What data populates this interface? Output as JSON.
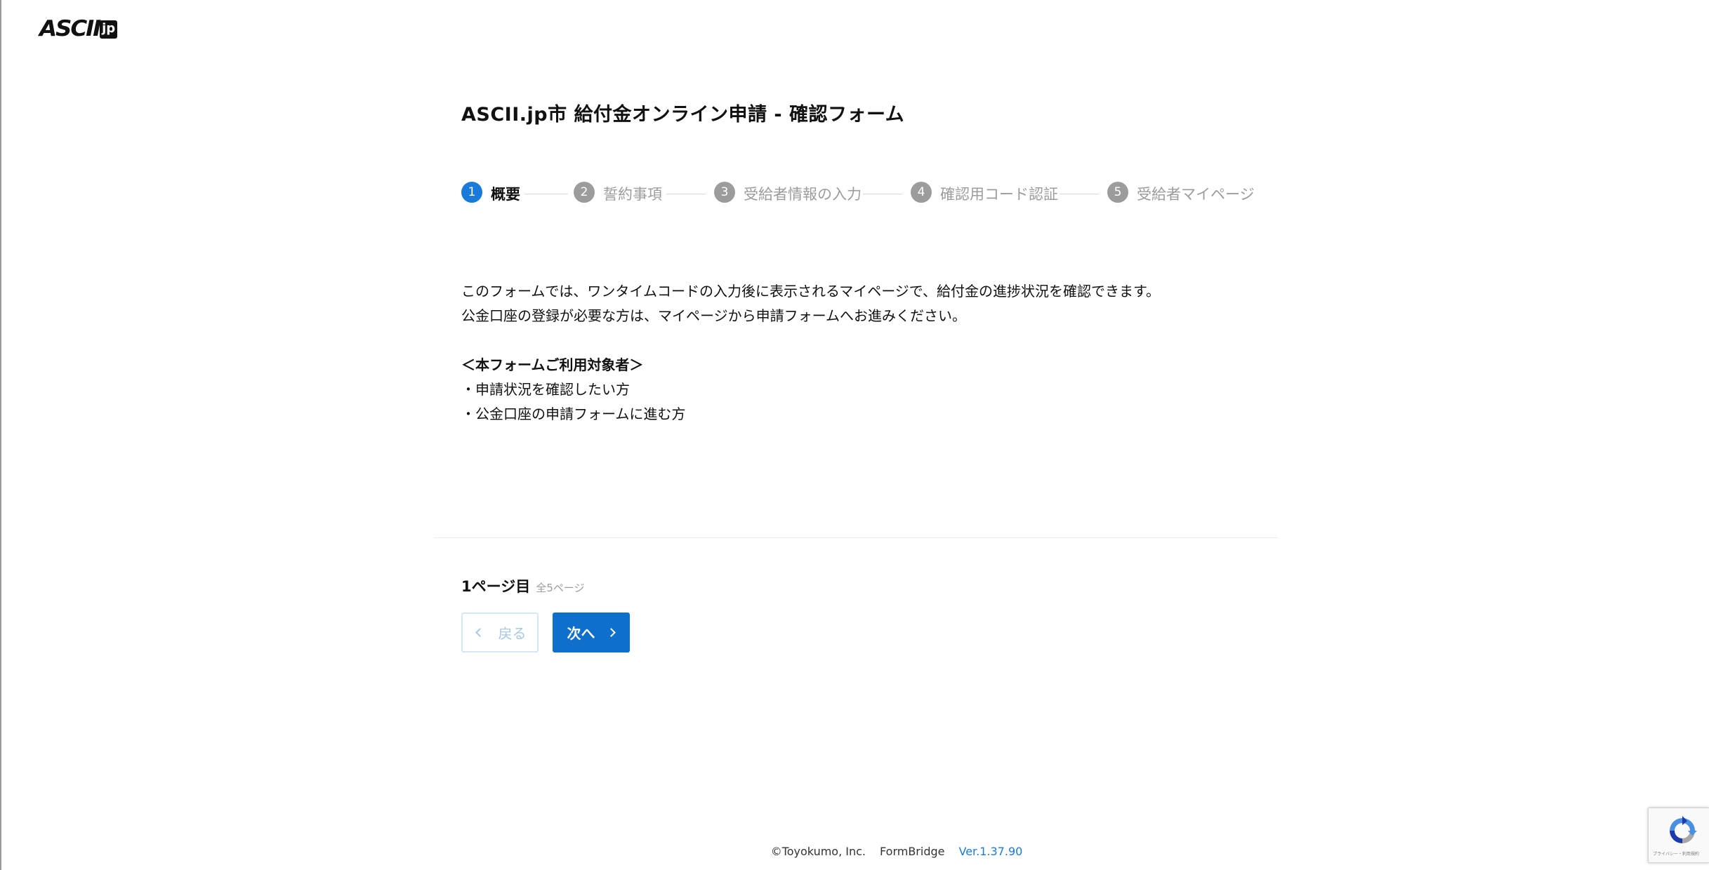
{
  "logo": {
    "main": "ASCII",
    "suffix": "jp"
  },
  "title": "ASCII.jp市 給付金オンライン申請 - 確認フォーム",
  "steps": [
    {
      "num": "1",
      "label": "概要",
      "active": true
    },
    {
      "num": "2",
      "label": "誓約事項",
      "active": false
    },
    {
      "num": "3",
      "label": "受給者情報の入力",
      "active": false
    },
    {
      "num": "4",
      "label": "確認用コード認証",
      "active": false
    },
    {
      "num": "5",
      "label": "受給者マイページ",
      "active": false
    }
  ],
  "description": {
    "line1": "このフォームでは、ワンタイムコードの入力後に表示されるマイページで、給付金の進捗状況を確認できます。",
    "line2": "公金口座の登録が必要な方は、マイページから申請フォームへお進みください。",
    "target_heading": "＜本フォームご利用対象者＞",
    "target_items": [
      "・申請状況を確認したい方",
      "・公金口座の申請フォームに進む方"
    ]
  },
  "pagination": {
    "current": "1ページ目",
    "total": "全5ページ",
    "back_label": "戻る",
    "next_label": "次へ"
  },
  "footer": {
    "copyright": "©Toyokumo, Inc.",
    "product": "FormBridge",
    "version": "Ver.1.37.90"
  },
  "recaptcha": {
    "links": "プライバシー・利用規約"
  },
  "colors": {
    "accent": "#1a7ad9",
    "button": "#0f6fcc",
    "inactive_step": "#9c9c9c"
  }
}
